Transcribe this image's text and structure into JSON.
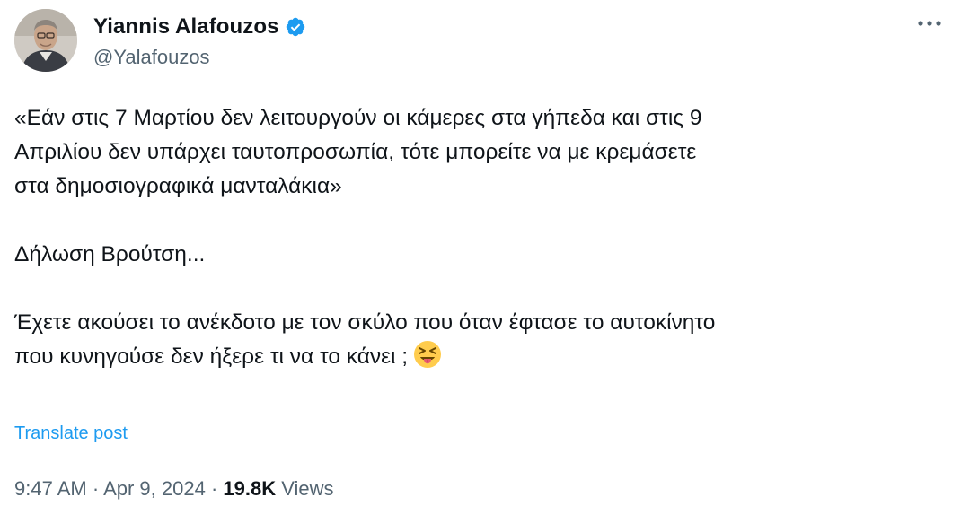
{
  "author": {
    "display_name": "Yiannis Alafouzos",
    "handle": "@Yalafouzos",
    "verified": true,
    "verified_color": "#1d9bf0"
  },
  "tweet": {
    "paragraphs": [
      {
        "lines": [
          "«Εάν στις 7 Μαρτίου δεν λειτουργούν οι κάμερες στα γήπεδα και στις 9",
          "Απριλίου δεν υπάρχει ταυτοπροσωπία, τότε μπορείτε να με κρεμάσετε",
          "στα δημοσιογραφικά μανταλάκια»"
        ]
      },
      {
        "lines": [
          "Δήλωση Βρούτση..."
        ]
      },
      {
        "lines": [
          "Έχετε ακούσει το ανέκδοτο με τον σκύλο που όταν έφτασε το  αυτοκίνητο",
          "που κυνηγούσε δεν ήξερε τι να το κάνει ;"
        ],
        "trailing_icon": "squinting-face-with-tongue-emoji"
      }
    ],
    "translate_label": "Translate post"
  },
  "meta": {
    "time": "9:47 AM",
    "separator": "·",
    "date": "Apr 9, 2024",
    "views_count": "19.8K",
    "views_label": "Views"
  },
  "icons": {
    "more": "more-options-icon",
    "verified": "verified-badge-icon"
  },
  "colors": {
    "link": "#1d9bf0",
    "text": "#0f1419",
    "secondary": "#536471"
  }
}
